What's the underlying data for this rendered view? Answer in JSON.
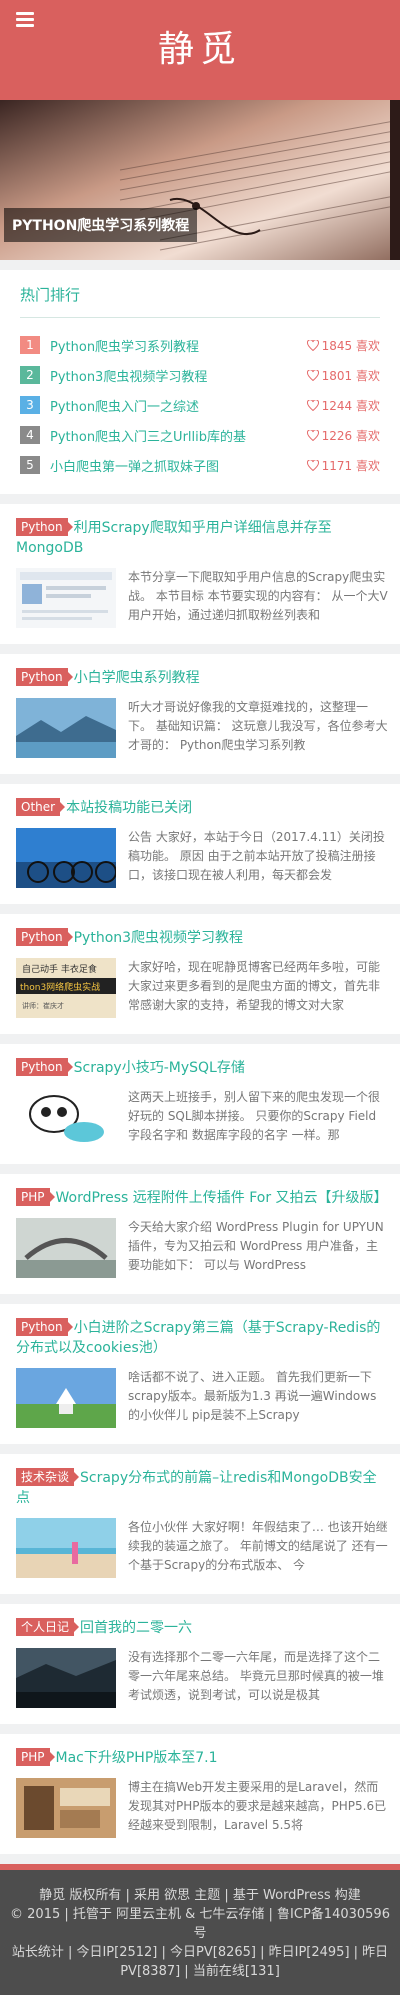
{
  "header": {
    "title": "静觅"
  },
  "hero": {
    "caption": "PYTHON爬虫学习系列教程"
  },
  "hot": {
    "title": "热门排行",
    "items": [
      {
        "rank": "1",
        "title": "Python爬虫学习系列教程",
        "likes": "1845 喜欢",
        "color": "#f28b82"
      },
      {
        "rank": "2",
        "title": "Python3爬虫视频学习教程",
        "likes": "1801 喜欢",
        "color": "#5ab89b"
      },
      {
        "rank": "3",
        "title": "Python爬虫入门一之综述",
        "likes": "1244 喜欢",
        "color": "#5ab0e5"
      },
      {
        "rank": "4",
        "title": "Python爬虫入门三之Urllib库的基",
        "likes": "1226 喜欢",
        "color": "#8a8a8a"
      },
      {
        "rank": "5",
        "title": "小白爬虫第一弹之抓取妹子图",
        "likes": "1171 喜欢",
        "color": "#8a8a8a"
      }
    ]
  },
  "posts": [
    {
      "tag": "Python",
      "title": "利用Scrapy爬取知乎用户详细信息并存至MongoDB",
      "excerpt": "本节分享一下爬取知乎用户信息的Scrapy爬虫实战。 本节目标 本节要实现的内容有： 从一个大V用户开始，通过递归抓取粉丝列表和"
    },
    {
      "tag": "Python",
      "title": "小白学爬虫系列教程",
      "excerpt": "听大才哥说好像我的文章挺难找的，这整理一下。 基础知识篇： 这玩意儿我没写，各位参考大才哥的： Python爬虫学习系列教"
    },
    {
      "tag": "Other",
      "title": "本站投稿功能已关闭",
      "excerpt": "公告 大家好，本站于今日（2017.4.11）关闭投稿功能。 原因 由于之前本站开放了投稿注册接口，该接口现在被人利用，每天都会发"
    },
    {
      "tag": "Python",
      "title": "Python3爬虫视频学习教程",
      "excerpt": "大家好哈，现在呢静觅博客已经两年多啦，可能大家过来更多看到的是爬虫方面的博文，首先非常感谢大家的支持，希望我的博文对大家"
    },
    {
      "tag": "Python",
      "title": "Scrapy小技巧-MySQL存储",
      "excerpt": "这两天上班接手，别人留下来的爬虫发现一个很好玩的 SQL脚本拼接。 只要你的Scrapy Field字段名字和 数据库字段的名字 一样。那"
    },
    {
      "tag": "PHP",
      "title": "WordPress 远程附件上传插件 For 又拍云【升级版】",
      "excerpt": "今天给大家介绍 WordPress Plugin for UPYUN 插件，专为又拍云和 WordPress 用户准备，主要功能如下： 可以与 WordPress"
    },
    {
      "tag": "Python",
      "title": "小白进阶之Scrapy第三篇（基于Scrapy-Redis的分布式以及cookies池）",
      "excerpt": "啥话都不说了、进入正题。 首先我们更新一下scrapy版本。最新版为1.3 再说一遍Windows的小伙伴儿 pip是装不上Scrapy"
    },
    {
      "tag": "技术杂谈",
      "title": "Scrapy分布式的前篇–让redis和MongoDB安全点",
      "excerpt": "各位小伙伴 大家好啊！年假结束了… 也该开始继续我的装逼之旅了。 年前博文的结尾说了 还有一个基于Scrapy的分布式版本、 今"
    },
    {
      "tag": "个人日记",
      "title": "回首我的二零一六",
      "excerpt": "没有选择那个二零一六年尾，而是选择了这个二零一六年尾来总结。 毕竟元旦那时候真的被一堆考试烦透，说到考试，可以说是极其"
    },
    {
      "tag": "PHP",
      "title": "Mac下升级PHP版本至7.1",
      "excerpt": "博主在搞Web开发主要采用的是Laravel，然而发现其对PHP版本的要求是越来越高，PHP5.6已经越来受到限制，Laravel 5.5将"
    }
  ],
  "footer": {
    "line1": "静觅 版权所有 | 采用 欲思 主题 | 基于 WordPress 构建",
    "line2": "© 2015 | 托管于 阿里云主机 & 七牛云存储 | 鲁ICP备14030596号",
    "line3": "站长统计 | 今日IP[2512] | 今日PV[8265] | 昨日IP[2495] | 昨日PV[8387] | 当前在线[131]"
  }
}
